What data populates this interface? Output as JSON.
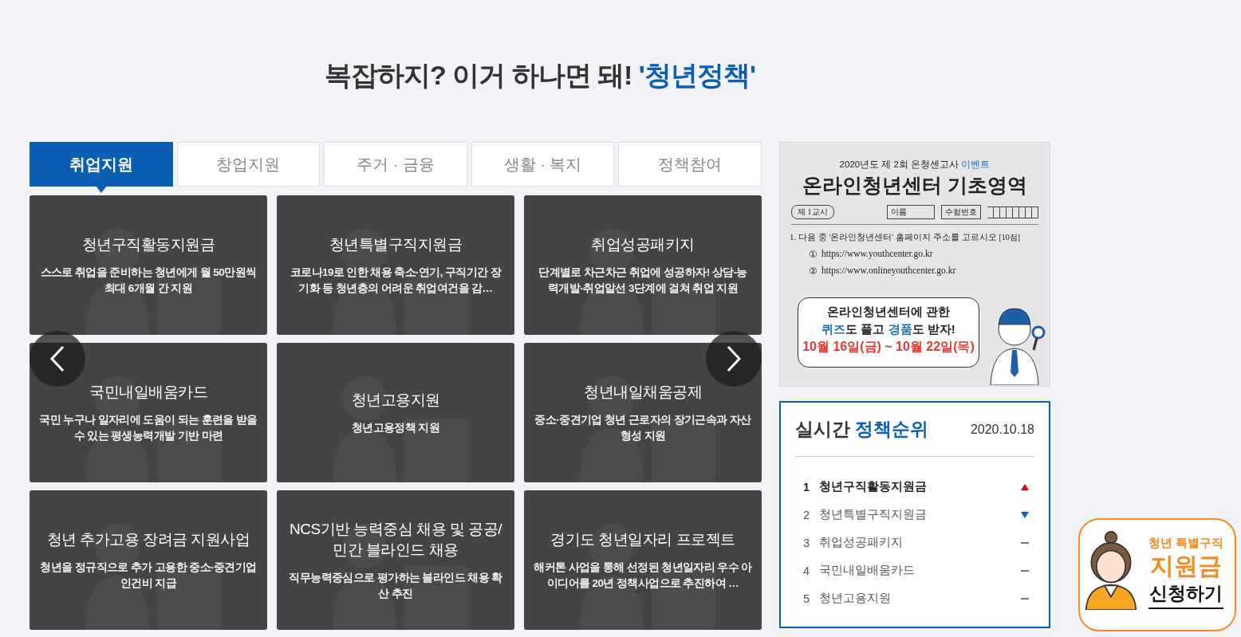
{
  "heading": {
    "lead": "복잡하지? 이거 하나면 돼! ",
    "accent": "'청년정책'"
  },
  "tabs": [
    {
      "label": "취업지원",
      "selected": true
    },
    {
      "label": "창업지원",
      "selected": false
    },
    {
      "label": "주거 · 금융",
      "selected": false
    },
    {
      "label": "생활 · 복지",
      "selected": false
    },
    {
      "label": "정책참여",
      "selected": false
    }
  ],
  "cards": [
    {
      "title": "청년구직활동지원금",
      "description": "스스로 취업을 준비하는 청년에게 월 50만원씩 최대 6개월 간 지원"
    },
    {
      "title": "청년특별구직지원금",
      "description": "코로나19로 인한 채용 축소·연기, 구직기간 장기화 등 청년층의 어려운 취업여건을 감…"
    },
    {
      "title": "취업성공패키지",
      "description": "단계별로 차근차근 취업에 성공하자! 상담-능력개발-취업알선 3단계에 걸쳐 취업 지원"
    },
    {
      "title": "국민내일배움카드",
      "description": "국민 누구나 일자리에 도움이 되는 훈련을 받을 수 있는 평생능력개발 기반 마련"
    },
    {
      "title": "청년고용지원",
      "description": "청년고용정책 지원"
    },
    {
      "title": "청년내일채움공제",
      "description": "중소·중견기업 청년 근로자의 장기근속과 자산형성 지원"
    },
    {
      "title": "청년 추가고용 장려금 지원사업",
      "description": "청년을 정규직으로 추가 고용한 중소·중견기업 인건비 지급"
    },
    {
      "title": "NCS기반 능력중심 채용 및 공공/민간 블라인드 채용",
      "description": "직무능력중심으로 평가하는 블라인드 채용 확산 추진"
    },
    {
      "title": "경기도 청년일자리 프로젝트",
      "description": "해커톤 사업을 통해 선정된 청년일자리 우수 아이디어를 20년 정책사업으로 추진하여 …"
    }
  ],
  "event_banner": {
    "subtitle": "2020년도 제 2회 온청센고사",
    "subtitle_accent": "이벤트",
    "headline": "온라인청년센터 기초영역",
    "period_label": "제 1교시",
    "name_label": "이름",
    "number_label": "수험번호",
    "question": "1. 다음 중 '온라인청년센터' 홈페이지 주소를 고르시오",
    "points": "[10점]",
    "options": [
      {
        "number": "①",
        "text": "https://www.youthcenter.go.kr"
      },
      {
        "number": "②",
        "text": "https://www.onlineyouthcenter.go.kr"
      }
    ],
    "bubble_line": "온라인청년센터에 관한",
    "bubble_parts": [
      {
        "text": "퀴즈",
        "accent": true
      },
      {
        "text": "도 풀고 ",
        "accent": false
      },
      {
        "text": "경품",
        "accent": true
      },
      {
        "text": "도 받자!",
        "accent": false
      }
    ],
    "dates": "10월 16일(금) ~ 10월 22일(목)"
  },
  "ranking": {
    "title": "실시간",
    "title_accent": "정책순위",
    "date": "2020.10.18",
    "items": [
      {
        "rank": "1",
        "name": "청년구직활동지원금",
        "kind": "up",
        "highlighted": true
      },
      {
        "rank": "2",
        "name": "청년특별구직지원금",
        "kind": "down",
        "highlighted": false
      },
      {
        "rank": "3",
        "name": "취업성공패키지",
        "kind": "same",
        "highlighted": false
      },
      {
        "rank": "4",
        "name": "국민내일배움카드",
        "kind": "same",
        "highlighted": false
      },
      {
        "rank": "5",
        "name": "청년고용지원",
        "kind": "same",
        "highlighted": false
      }
    ]
  },
  "float_banner": {
    "line1": "청년 특별구직",
    "line2": "지원금",
    "line3": "신청하기"
  }
}
